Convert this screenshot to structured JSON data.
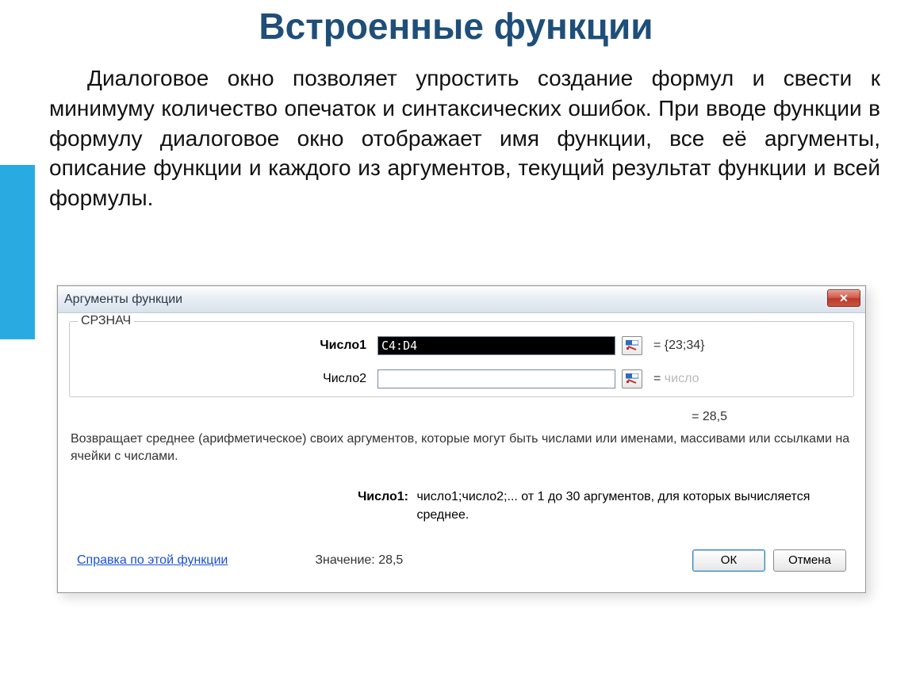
{
  "slide": {
    "title": "Встроенные функции",
    "paragraph": "Диалоговое окно позволяет упростить создание формул и свести к минимуму количество опечаток и синтаксических ошибок. При вводе функции в формулу диалоговое окно отображает имя функции, все её аргументы, описание функции и каждого из аргументов, текущий результат функции и всей формулы."
  },
  "dialog": {
    "title": "Аргументы функции",
    "function_name": "СРЗНАЧ",
    "args": [
      {
        "label": "Число1",
        "bold": true,
        "value": "C4:D4",
        "filled": true,
        "result": "= {23;34}",
        "placeholder": ""
      },
      {
        "label": "Число2",
        "bold": false,
        "value": "",
        "filled": false,
        "result": "= ",
        "placeholder": "число"
      }
    ],
    "intermediate_result": "= 28,5",
    "description": "Возвращает среднее (арифметическое) своих аргументов, которые могут быть числами или именами, массивами или ссылками на ячейки с числами.",
    "arg_help_label": "Число1:",
    "arg_help_text": "число1;число2;... от 1 до 30 аргументов, для которых вычисляется среднее.",
    "help_link": "Справка по этой функции",
    "value_prefix": "Значение:",
    "value": "28,5",
    "ok": "ОК",
    "cancel": "Отмена"
  }
}
